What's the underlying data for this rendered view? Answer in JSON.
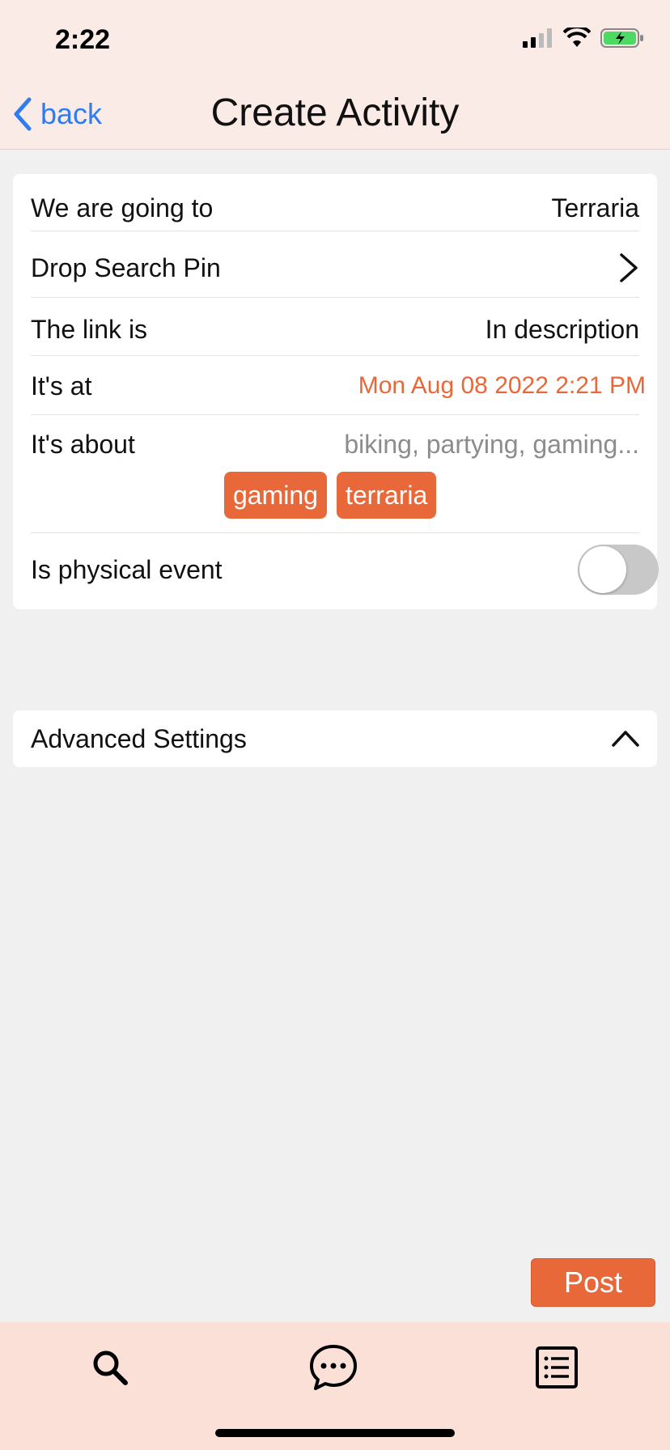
{
  "status": {
    "time": "2:22"
  },
  "nav": {
    "back_label": "back",
    "title": "Create Activity"
  },
  "form": {
    "going_to": {
      "label": "We are going to",
      "value": "Terraria"
    },
    "drop_pin": {
      "label": "Drop Search Pin"
    },
    "link": {
      "label": "The link is",
      "value": "In description"
    },
    "at": {
      "label": "It's at",
      "value": "Mon Aug 08 2022 2:21 PM"
    },
    "about": {
      "label": "It's about",
      "placeholder": "biking, partying, gaming...",
      "tags": [
        "gaming",
        "terraria"
      ]
    },
    "physical": {
      "label": "Is physical event",
      "enabled": false
    }
  },
  "advanced": {
    "label": "Advanced Settings",
    "expanded": true
  },
  "post_label": "Post",
  "tabbar": {
    "icons": [
      "search-icon",
      "chat-icon",
      "list-icon"
    ]
  },
  "colors": {
    "accent": "#e9683a",
    "link": "#2f7bf0",
    "header_bg": "#fbebe7",
    "tabbar_bg": "#fbe0d8"
  }
}
